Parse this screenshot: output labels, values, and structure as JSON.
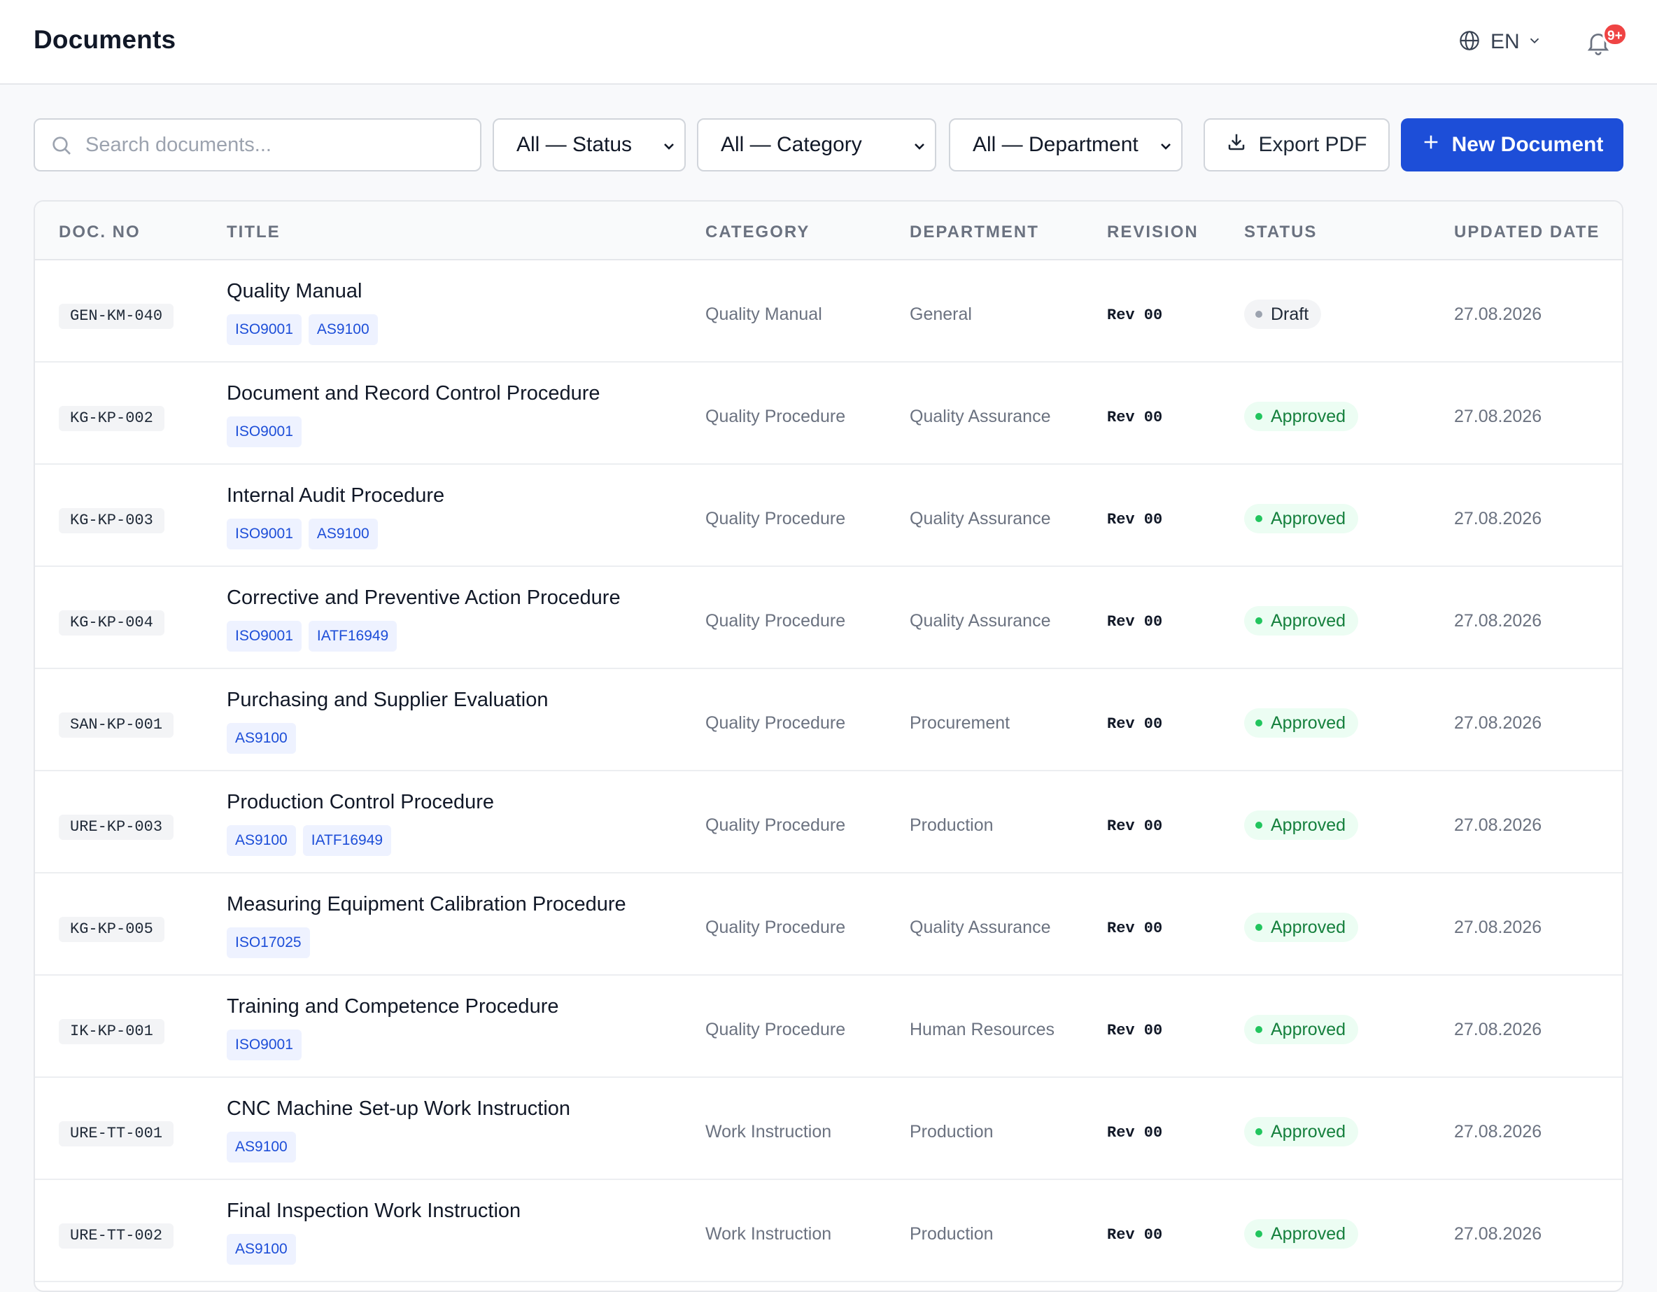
{
  "header": {
    "title": "Documents",
    "language": "EN",
    "notifications_badge": "9+"
  },
  "toolbar": {
    "search_placeholder": "Search documents...",
    "status_filter": "All — Status",
    "category_filter": "All — Category",
    "department_filter": "All — Department",
    "export_label": "Export PDF",
    "new_label": "New Document"
  },
  "table": {
    "columns": [
      "DOC. NO",
      "TITLE",
      "CATEGORY",
      "DEPARTMENT",
      "REVISION",
      "STATUS",
      "UPDATED DATE"
    ],
    "rows": [
      {
        "doc_no": "GEN-KM-040",
        "title": "Quality Manual",
        "tags": [
          "ISO9001",
          "AS9100"
        ],
        "category": "Quality Manual",
        "department": "General",
        "revision": "Rev 00",
        "status": "Draft",
        "updated": "27.08.2026"
      },
      {
        "doc_no": "KG-KP-002",
        "title": "Document and Record Control Procedure",
        "tags": [
          "ISO9001"
        ],
        "category": "Quality Procedure",
        "department": "Quality Assurance",
        "revision": "Rev 00",
        "status": "Approved",
        "updated": "27.08.2026"
      },
      {
        "doc_no": "KG-KP-003",
        "title": "Internal Audit Procedure",
        "tags": [
          "ISO9001",
          "AS9100"
        ],
        "category": "Quality Procedure",
        "department": "Quality Assurance",
        "revision": "Rev 00",
        "status": "Approved",
        "updated": "27.08.2026"
      },
      {
        "doc_no": "KG-KP-004",
        "title": "Corrective and Preventive Action Procedure",
        "tags": [
          "ISO9001",
          "IATF16949"
        ],
        "category": "Quality Procedure",
        "department": "Quality Assurance",
        "revision": "Rev 00",
        "status": "Approved",
        "updated": "27.08.2026"
      },
      {
        "doc_no": "SAN-KP-001",
        "title": "Purchasing and Supplier Evaluation",
        "tags": [
          "AS9100"
        ],
        "category": "Quality Procedure",
        "department": "Procurement",
        "revision": "Rev 00",
        "status": "Approved",
        "updated": "27.08.2026"
      },
      {
        "doc_no": "URE-KP-003",
        "title": "Production Control Procedure",
        "tags": [
          "AS9100",
          "IATF16949"
        ],
        "category": "Quality Procedure",
        "department": "Production",
        "revision": "Rev 00",
        "status": "Approved",
        "updated": "27.08.2026"
      },
      {
        "doc_no": "KG-KP-005",
        "title": "Measuring Equipment Calibration Procedure",
        "tags": [
          "ISO17025"
        ],
        "category": "Quality Procedure",
        "department": "Quality Assurance",
        "revision": "Rev 00",
        "status": "Approved",
        "updated": "27.08.2026"
      },
      {
        "doc_no": "IK-KP-001",
        "title": "Training and Competence Procedure",
        "tags": [
          "ISO9001"
        ],
        "category": "Quality Procedure",
        "department": "Human Resources",
        "revision": "Rev 00",
        "status": "Approved",
        "updated": "27.08.2026"
      },
      {
        "doc_no": "URE-TT-001",
        "title": "CNC Machine Set-up Work Instruction",
        "tags": [
          "AS9100"
        ],
        "category": "Work Instruction",
        "department": "Production",
        "revision": "Rev 00",
        "status": "Approved",
        "updated": "27.08.2026"
      },
      {
        "doc_no": "URE-TT-002",
        "title": "Final Inspection Work Instruction",
        "tags": [
          "AS9100"
        ],
        "category": "Work Instruction",
        "department": "Production",
        "revision": "Rev 00",
        "status": "Approved",
        "updated": "27.08.2026"
      }
    ]
  },
  "colors": {
    "primary": "#1d4ed8",
    "approved_bg": "#ecfdf3",
    "approved_text": "#15803d",
    "draft_bg": "#f3f4f6",
    "badge": "#ef4444"
  },
  "icons": {
    "language": "globe-icon",
    "notifications": "bell-icon",
    "search": "search-icon",
    "export": "download-icon",
    "new": "plus-icon"
  }
}
